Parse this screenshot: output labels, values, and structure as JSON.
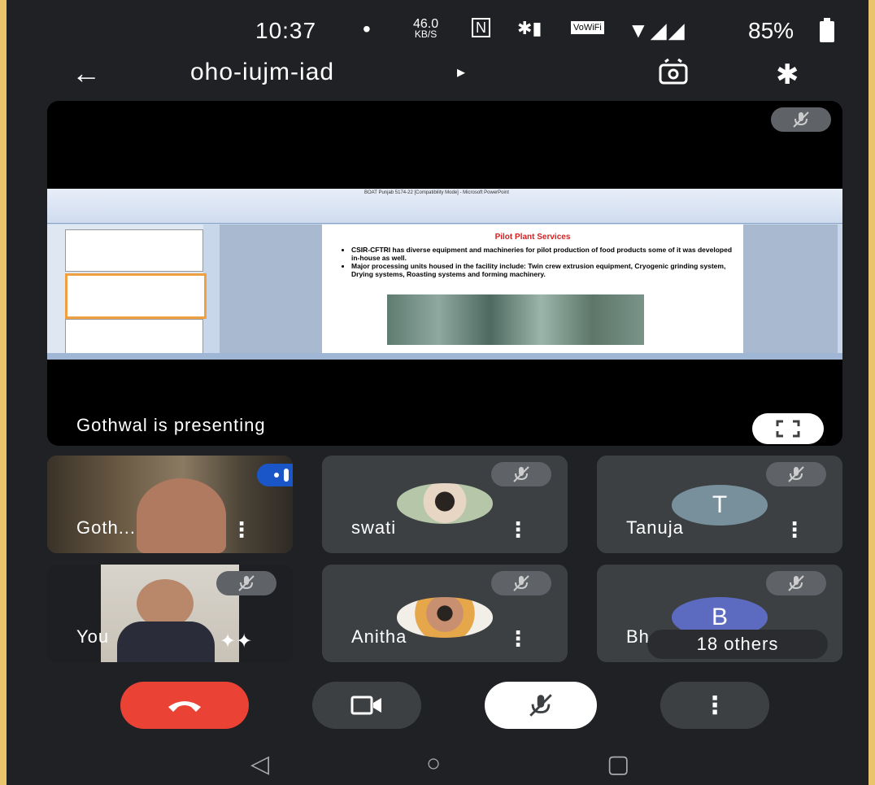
{
  "status_bar": {
    "time": "10:37",
    "dot": "•",
    "speed_value": "46.0",
    "speed_unit": "KB/S",
    "nfc_icon": "N",
    "bt_vibrate_icon": "✱▮",
    "vowifi_icon": "VoWiFi",
    "signal_icon": "▼◢◢",
    "battery": "85%"
  },
  "top_bar": {
    "back_icon": "←",
    "meeting_code": "oho-iujm-iad",
    "title_arrow": "▸",
    "bluetooth_icon": "✱"
  },
  "presentation": {
    "presenting_text": "Gothwal is presenting",
    "slide": {
      "ribbon_title": "BOAT Punjab 5174-22 [Compatibility Mode] - Microsoft PowerPoint",
      "title": "Pilot Plant Services",
      "bullets": [
        "CSIR-CFTRI has diverse equipment and machineries for pilot production of food products some of it was developed in-house as well.",
        "Major processing units housed in the facility include: Twin crew extrusion equipment, Cryogenic grinding system, Drying systems, Roasting systems and forming machinery."
      ]
    }
  },
  "participants": [
    {
      "name": "Goth...",
      "type": "video",
      "speaking": true
    },
    {
      "name": "swati",
      "type": "photo",
      "muted": true
    },
    {
      "name": "Tanuja",
      "type": "letter",
      "letter": "T",
      "color": "#78909c",
      "muted": true
    },
    {
      "name": "You",
      "type": "video",
      "muted": true
    },
    {
      "name": "Anitha",
      "type": "photo",
      "muted": true
    },
    {
      "name": "Bh",
      "type": "letter",
      "letter": "B",
      "color": "#5c6bc0",
      "muted": true,
      "overlay": "18 others"
    }
  ],
  "others_label": "18 others",
  "sparkle_icon": "✦✦",
  "more_icon": "⋮",
  "controls": {
    "end_call": "end-call",
    "camera": "camera",
    "mic": "mic-off",
    "more": "⋮"
  },
  "nav": {
    "back": "◁",
    "home": "○",
    "recents": "▢"
  },
  "colors": {
    "background": "#202124",
    "tile": "#3c4043",
    "end_call": "#ea4335",
    "speaking": "#1a56c8",
    "letter_t": "#78909c",
    "letter_b": "#5c6bc0"
  }
}
